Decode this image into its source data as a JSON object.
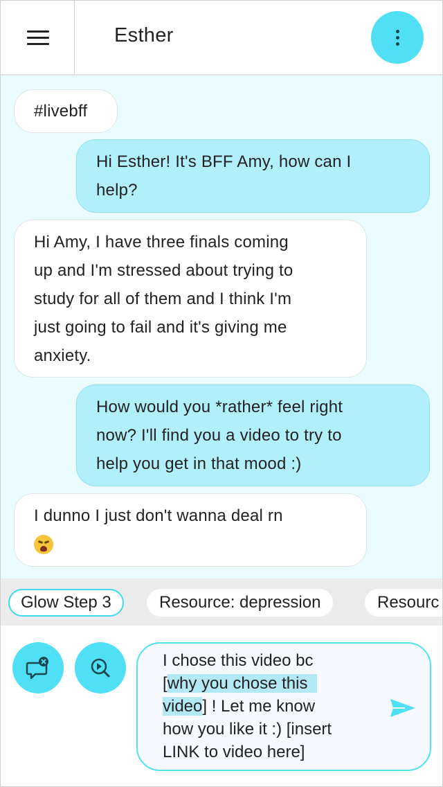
{
  "header": {
    "title": "Esther"
  },
  "messages": [
    {
      "side": "in",
      "text": "#livebff"
    },
    {
      "side": "out",
      "lines": [
        "Hi Esther! It's BFF Amy, how can I",
        "help?"
      ]
    },
    {
      "side": "in",
      "lines": [
        "Hi Amy, I have three finals coming",
        "up and I'm stressed about trying to",
        "study for all of them and I think I'm",
        "just going to fail and it's giving me",
        "anxiety."
      ]
    },
    {
      "side": "out",
      "lines": [
        "How would you *rather* feel right",
        "now? I'll find you a video to try to",
        "help you get in that mood :)"
      ]
    },
    {
      "side": "in",
      "lines": [
        "I dunno I just don't wanna deal rn"
      ],
      "emoji": "weary-face-emoji"
    }
  ],
  "chips": [
    "Glow Step 3",
    "Resource: depression",
    "Resourc"
  ],
  "composer": {
    "line1": "I chose this video bc",
    "bracket_open": "[",
    "highlight_a": "why you chose this",
    "highlight_b": "video",
    "after_highlight": "] !  Let me know",
    "line4": "how you like it :)  [insert",
    "line5": "LINK to video here]"
  },
  "colors": {
    "accent": "#4fe0f6",
    "outgoing_bubble": "#b1effa",
    "chat_background": "#eafcfd",
    "chip_bar": "#ececec",
    "highlight": "#b5e8f5"
  },
  "icons": {
    "menu": "hamburger-menu-icon",
    "more": "more-vertical-icon",
    "end_chat": "chat-close-icon",
    "video_search": "video-search-icon",
    "send": "send-icon",
    "emoji": "weary-face-emoji"
  }
}
